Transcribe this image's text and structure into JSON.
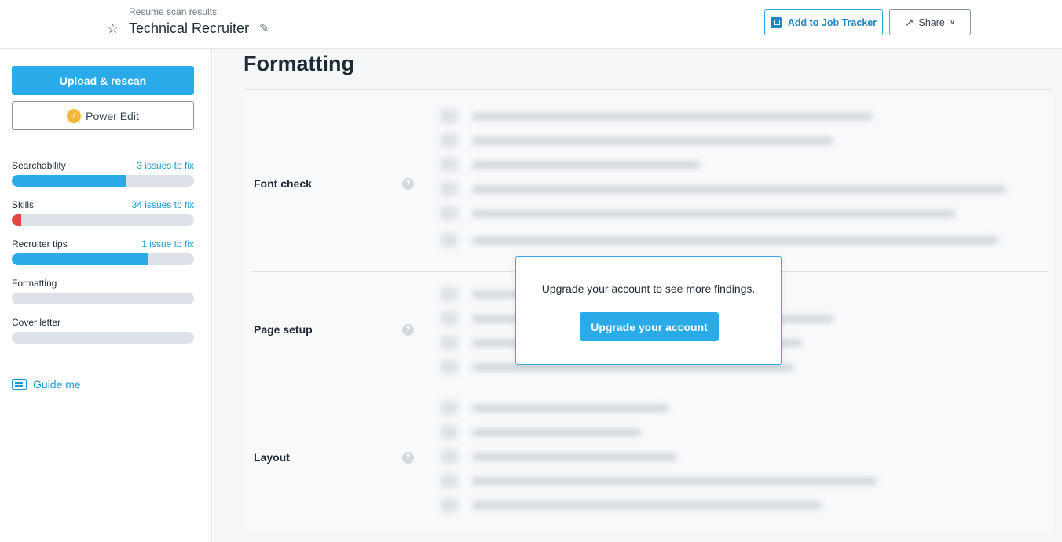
{
  "header": {
    "subtitle": "Resume scan results",
    "title": "Technical Recruiter",
    "add_tracker_label": "Add to Job Tracker",
    "share_label": "Share"
  },
  "sidebar": {
    "upload_label": "Upload & rescan",
    "power_edit_label": "Power Edit",
    "metrics": [
      {
        "label": "Searchability",
        "issues": "3 issues to fix",
        "progress_pct": 63,
        "color": "#2aaae8"
      },
      {
        "label": "Skills",
        "issues": "34 issues to fix",
        "progress_pct": 5,
        "color": "#e84545"
      },
      {
        "label": "Recruiter tips",
        "issues": "1 issue to fix",
        "progress_pct": 75,
        "color": "#2aaae8"
      },
      {
        "label": "Formatting",
        "issues": "",
        "progress_pct": 0,
        "color": "#2aaae8"
      },
      {
        "label": "Cover letter",
        "issues": "",
        "progress_pct": 0,
        "color": "#2aaae8"
      }
    ],
    "guide_label": "Guide me"
  },
  "main": {
    "section_title": "Formatting",
    "rows": [
      {
        "label": "Font check"
      },
      {
        "label": "Page setup"
      },
      {
        "label": "Layout"
      }
    ],
    "help_glyph": "?"
  },
  "modal": {
    "message": "Upgrade your account to see more findings.",
    "button_label": "Upgrade your account"
  },
  "icons": {
    "star": "star-icon",
    "pencil": "pencil-icon",
    "tracker": "tracker-icon",
    "share": "share-icon",
    "chevron": "chevron-down-icon",
    "bolt": "lightning-icon",
    "guide": "guide-icon"
  },
  "colors": {
    "accent": "#2aaae8",
    "danger": "#e84545",
    "link": "#1a9ad6"
  }
}
